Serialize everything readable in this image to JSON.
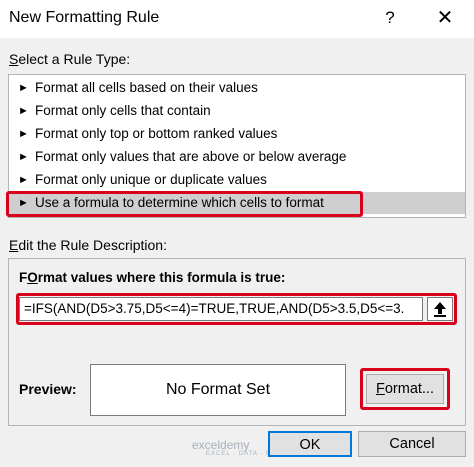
{
  "dialog": {
    "title": "New Formatting Rule",
    "help_glyph": "?",
    "close_glyph": "✕"
  },
  "rule_type": {
    "heading_underlined": "S",
    "heading_rest": "elect a Rule Type:",
    "items": [
      {
        "arrow": "►",
        "label": "Format all cells based on their values"
      },
      {
        "arrow": "►",
        "label": "Format only cells that contain"
      },
      {
        "arrow": "►",
        "label": "Format only top or bottom ranked values"
      },
      {
        "arrow": "►",
        "label": "Format only values that are above or below average"
      },
      {
        "arrow": "►",
        "label": "Format only unique or duplicate values"
      },
      {
        "arrow": "►",
        "label": "Use a formula to determine which cells to format"
      }
    ],
    "selected_index": 5
  },
  "description": {
    "heading_underlined": "E",
    "heading_rest": "dit the Rule Description:",
    "formula_label_underlined": "O",
    "formula_label_pre": "F",
    "formula_label_post": "rmat values where this formula is true:",
    "formula_value": "=IFS(AND(D5>3.75,D5<=4)=TRUE,TRUE,AND(D5>3.5,D5<=3.",
    "collapse_icon": "arrow-up-icon",
    "preview_label": "Preview:",
    "preview_text": "No Format Set",
    "format_button_underlined": "F",
    "format_button_rest": "ormat..."
  },
  "footer": {
    "ok_label": "OK",
    "cancel_label": "Cancel",
    "watermark": "exceldemy",
    "watermark_sub": "EXCEL · DATA · BI"
  },
  "colors": {
    "highlight": "#d9001b",
    "ok_border": "#0078d7",
    "selected_bg": "#cfcfcf"
  }
}
